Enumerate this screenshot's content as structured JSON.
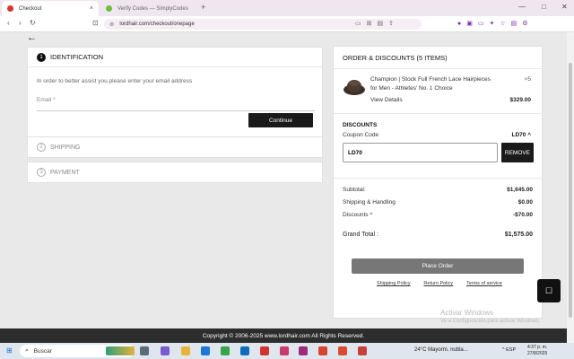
{
  "browser": {
    "tabs": [
      {
        "title": "Checkout",
        "active": true,
        "close": "×"
      },
      {
        "title": "Verify Codes — SimplyCodes",
        "active": false
      }
    ],
    "new_tab": "+",
    "window_controls": [
      "—",
      "□",
      "✕"
    ],
    "nav": {
      "back": "‹",
      "forward": "›",
      "reload": "↻",
      "bookmark": "⊡"
    },
    "url": "lordhair.com/checkout/onepage"
  },
  "page": {
    "back": "←",
    "identification": {
      "step": "1",
      "title": "IDENTIFICATION",
      "message": "In order to better assist you,please enter your email address",
      "email_label": "Email *",
      "email_value": "",
      "continue_label": "Continue"
    },
    "shipping": {
      "step": "2",
      "title": "SHIPPING"
    },
    "payment": {
      "step": "3",
      "title": "PAYMENT"
    },
    "order": {
      "title": "ORDER & DISCOUNTS (5 ITEMS)",
      "product": {
        "name": "Champion | Stock Full French Lace Hairpieces for Men - Athletes' No. 1 Choice",
        "qty": "×5",
        "view_details": "View Details",
        "price": "$329.00"
      },
      "discounts": {
        "title": "DISCOUNTS",
        "coupon_label": "Coupon Code",
        "coupon_code": "LD70 ^",
        "coupon_value": "LD70",
        "remove_label": "REMOVE"
      },
      "summary": [
        {
          "label": "Subtotal:",
          "value": "$1,645.00"
        },
        {
          "label": "Shipping & Handling",
          "value": "$0.00"
        },
        {
          "label": "Discounts ^",
          "value": "-$70.00"
        }
      ],
      "total": {
        "label": "Grand Total :",
        "value": "$1,575.00"
      },
      "place_order": "Place Order",
      "links": [
        "Shipping Policy",
        "Return Policy",
        "Terms of service"
      ]
    },
    "watermark": {
      "line1": "Activar Windows",
      "line2": "Ve a Configuración para activar Windows."
    },
    "footer": "Copyright © 2006-2025 www.lordhair.com All Rights Reserved."
  },
  "taskbar": {
    "search_label": "Buscar",
    "weather": "24°C  Mayorm. nubla...",
    "tray": "^  ESP",
    "time": "4:37 p. m.",
    "date": "27/8/2025"
  },
  "colors": {
    "dark_button": "#1a1a1a",
    "place_order_button": "#777777",
    "footer": "#2d2d2d"
  }
}
